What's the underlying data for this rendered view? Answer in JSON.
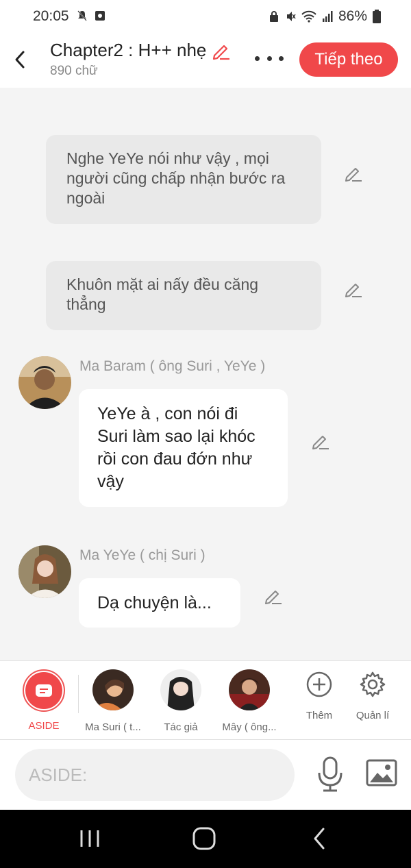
{
  "status_bar": {
    "time": "20:05",
    "battery": "86%",
    "left_icons": [
      "mute-bell-icon",
      "app-notification-icon"
    ],
    "right_icons": [
      "lock-icon",
      "vibrate-mute-icon",
      "wifi-icon",
      "signal-icon",
      "battery-icon"
    ]
  },
  "header": {
    "back_icon": "chevron-left-icon",
    "title": "Chapter2 : H++ nhẹ",
    "word_count": "890 chữ",
    "more_icon": "more-dots-icon",
    "next_label": "Tiếp theo"
  },
  "chat": {
    "narrations": [
      "Nghe YeYe nói như vậy , mọi người cũng chấp nhận bước ra ngoài",
      "Khuôn mặt ai nấy đều căng thẳng"
    ],
    "messages": [
      {
        "speaker": "Ma Baram ( ông Suri , YeYe )",
        "text": "YeYe à , con nói đi Suri làm sao lại khóc rồi con đau đớn như vậy"
      },
      {
        "speaker": "Ma YeYe ( chị Suri )",
        "text": "Dạ chuyện là..."
      }
    ]
  },
  "characters": [
    {
      "label": "ASIDE",
      "selected": true
    },
    {
      "label": "Ma Suri ( t..."
    },
    {
      "label": "Tác giả"
    },
    {
      "label": "Mây ( ông..."
    },
    {
      "label": "Thêm",
      "icon": "plus-circle-icon"
    },
    {
      "label": "Quản lí",
      "icon": "gear-icon"
    }
  ],
  "input": {
    "placeholder": "ASIDE:",
    "mic_icon": "microphone-icon",
    "image_icon": "image-icon"
  },
  "nav": [
    "recent-apps-icon",
    "home-icon",
    "back-icon"
  ],
  "colors": {
    "accent": "#f0484a",
    "background": "#f4f4f4",
    "narration_bg": "#e9e9e9"
  }
}
